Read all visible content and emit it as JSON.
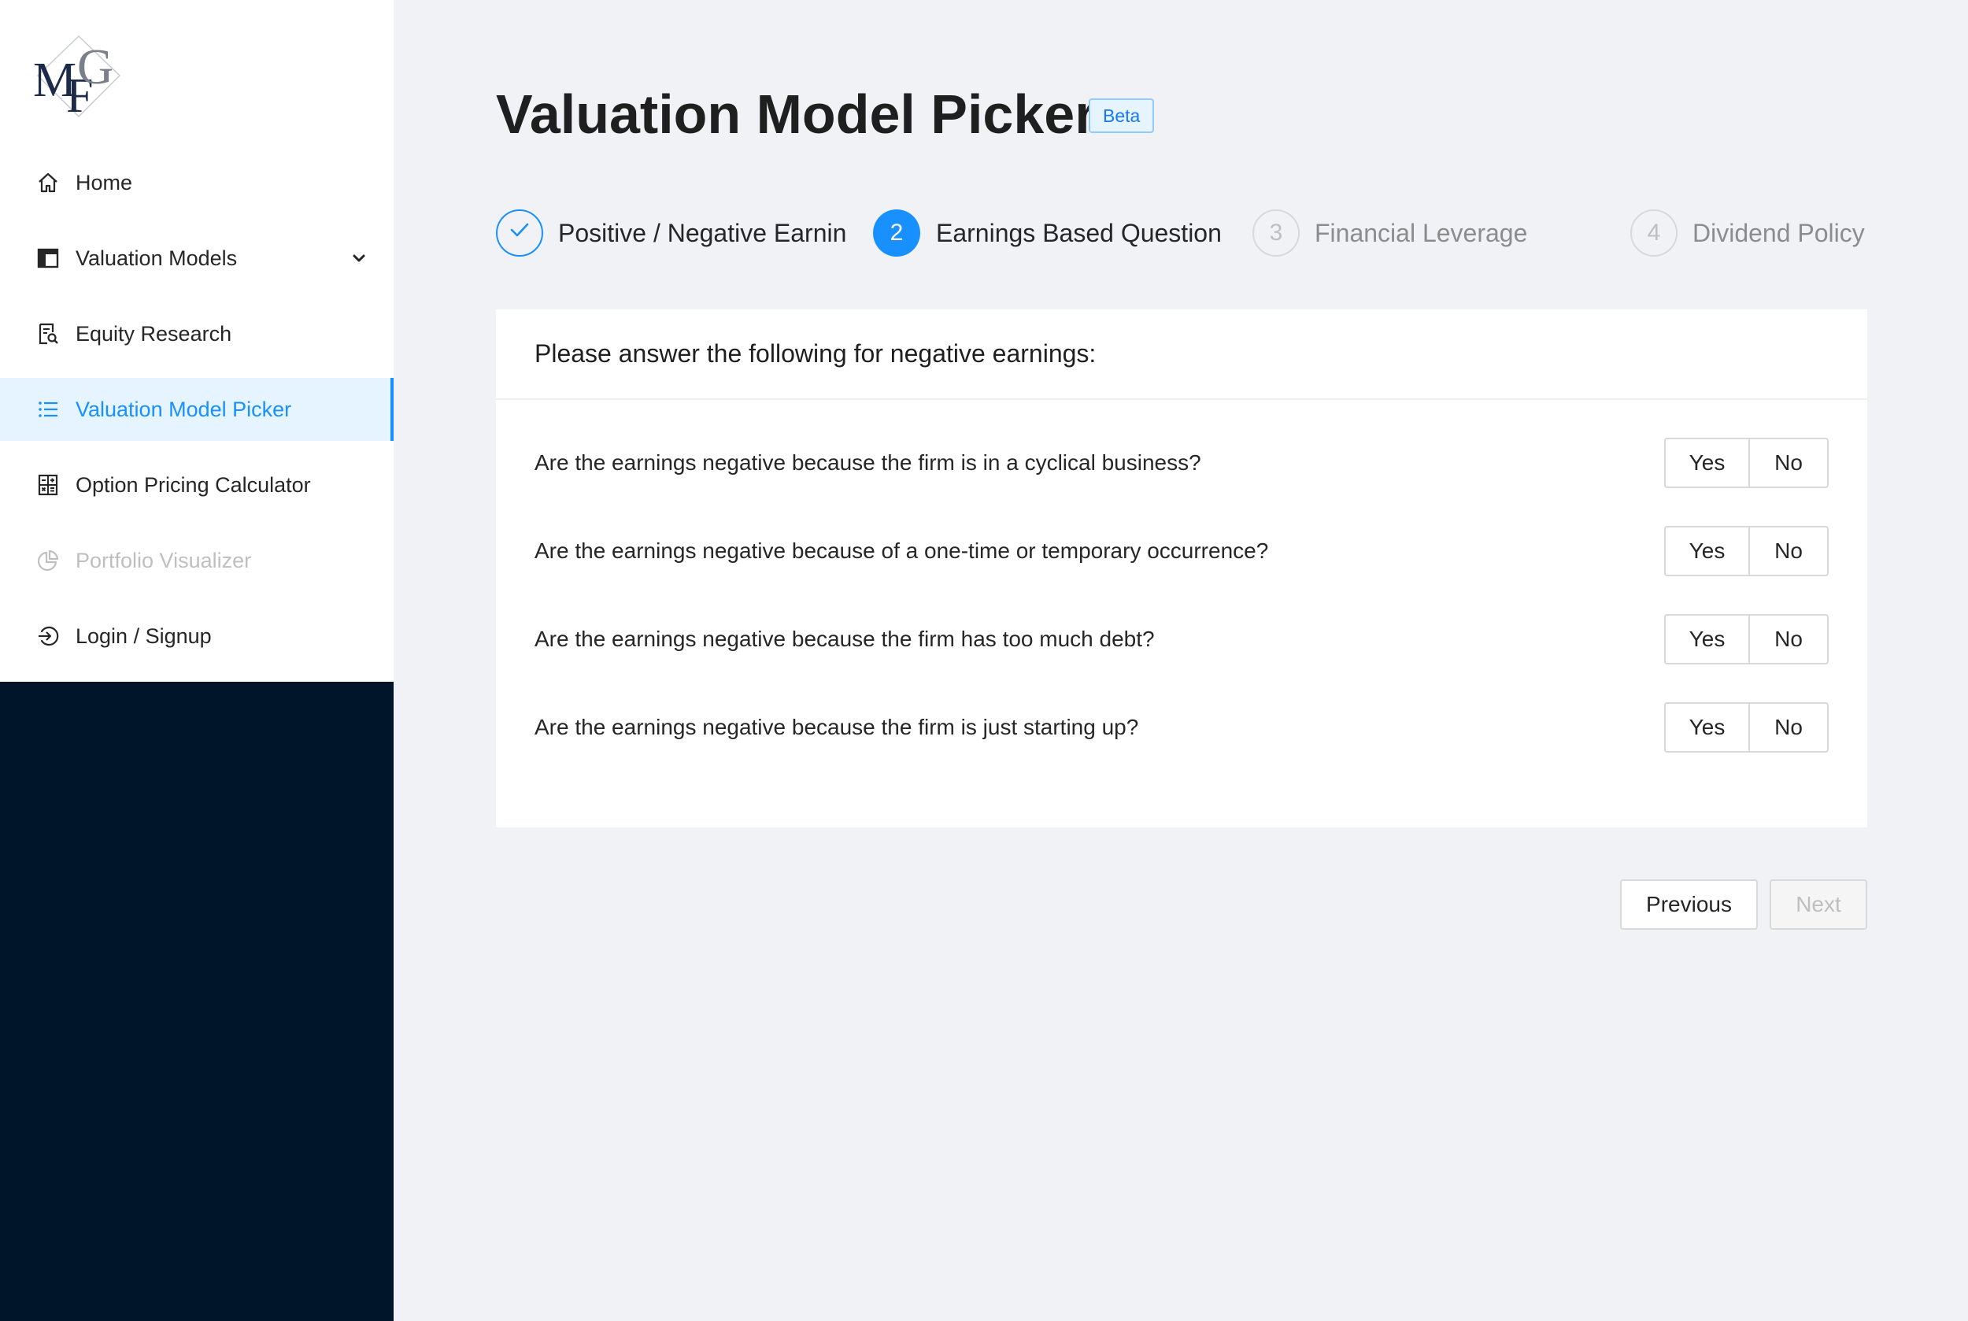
{
  "sidebar": {
    "logo_icon": "mfg-monogram-logo",
    "items": [
      {
        "label": "Home",
        "icon": "home-icon",
        "state": "normal"
      },
      {
        "label": "Valuation Models",
        "icon": "layout-icon",
        "state": "normal",
        "has_submenu": true
      },
      {
        "label": "Equity Research",
        "icon": "file-search-icon",
        "state": "normal"
      },
      {
        "label": "Valuation Model Picker",
        "icon": "list-icon",
        "state": "selected"
      },
      {
        "label": "Option Pricing Calculator",
        "icon": "calculator-icon",
        "state": "normal"
      },
      {
        "label": "Portfolio Visualizer",
        "icon": "pie-chart-icon",
        "state": "disabled"
      },
      {
        "label": "Login / Signup",
        "icon": "login-icon",
        "state": "normal"
      }
    ]
  },
  "header": {
    "title": "Valuation Model Picker",
    "badge": "Beta"
  },
  "steps": [
    {
      "number": "1",
      "title": "Positive / Negative Earnin",
      "status": "finished"
    },
    {
      "number": "2",
      "title": "Earnings Based Question",
      "status": "active"
    },
    {
      "number": "3",
      "title": "Financial Leverage",
      "status": "waiting"
    },
    {
      "number": "4",
      "title": "Dividend Policy",
      "status": "waiting"
    }
  ],
  "card": {
    "heading": "Please answer the following for negative earnings:",
    "questions": [
      {
        "text": "Are the earnings negative because the firm is in a cyclical business?",
        "yes": "Yes",
        "no": "No"
      },
      {
        "text": "Are the earnings negative because of a one-time or temporary occurrence?",
        "yes": "Yes",
        "no": "No"
      },
      {
        "text": "Are the earnings negative because the firm has too much debt?",
        "yes": "Yes",
        "no": "No"
      },
      {
        "text": "Are the earnings negative because the firm is just starting up?",
        "yes": "Yes",
        "no": "No"
      }
    ]
  },
  "footer": {
    "previous_label": "Previous",
    "next_label": "Next",
    "next_disabled": true
  },
  "colors": {
    "primary": "#1890ff",
    "sidebar_dark": "#001529",
    "content_bg": "#f0f2f5"
  }
}
